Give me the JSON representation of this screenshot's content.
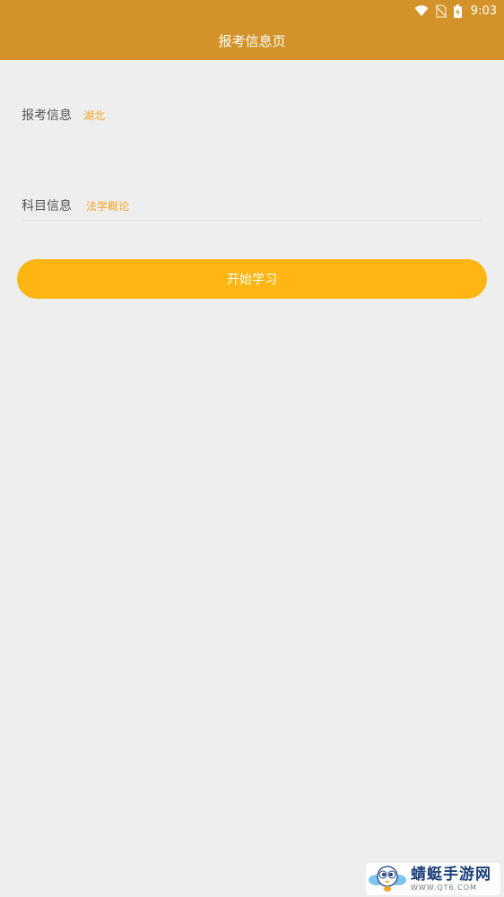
{
  "status_bar": {
    "time": "9:03",
    "icons": [
      "wifi-icon",
      "no-sim-icon",
      "battery-charging-icon"
    ]
  },
  "header": {
    "title": "报考信息页"
  },
  "form": {
    "region": {
      "label": "报考信息",
      "value": "湖北"
    },
    "subject": {
      "label": "科目信息",
      "value": "法学概论"
    }
  },
  "actions": {
    "start_label": "开始学习"
  },
  "watermark": {
    "name": "蜻蜓手游网",
    "url": "WWW.QT6.COM"
  },
  "colors": {
    "appbar": "#d3932a",
    "accent": "#ffb612",
    "value_text": "#f5a623",
    "background": "#eeeeee"
  }
}
